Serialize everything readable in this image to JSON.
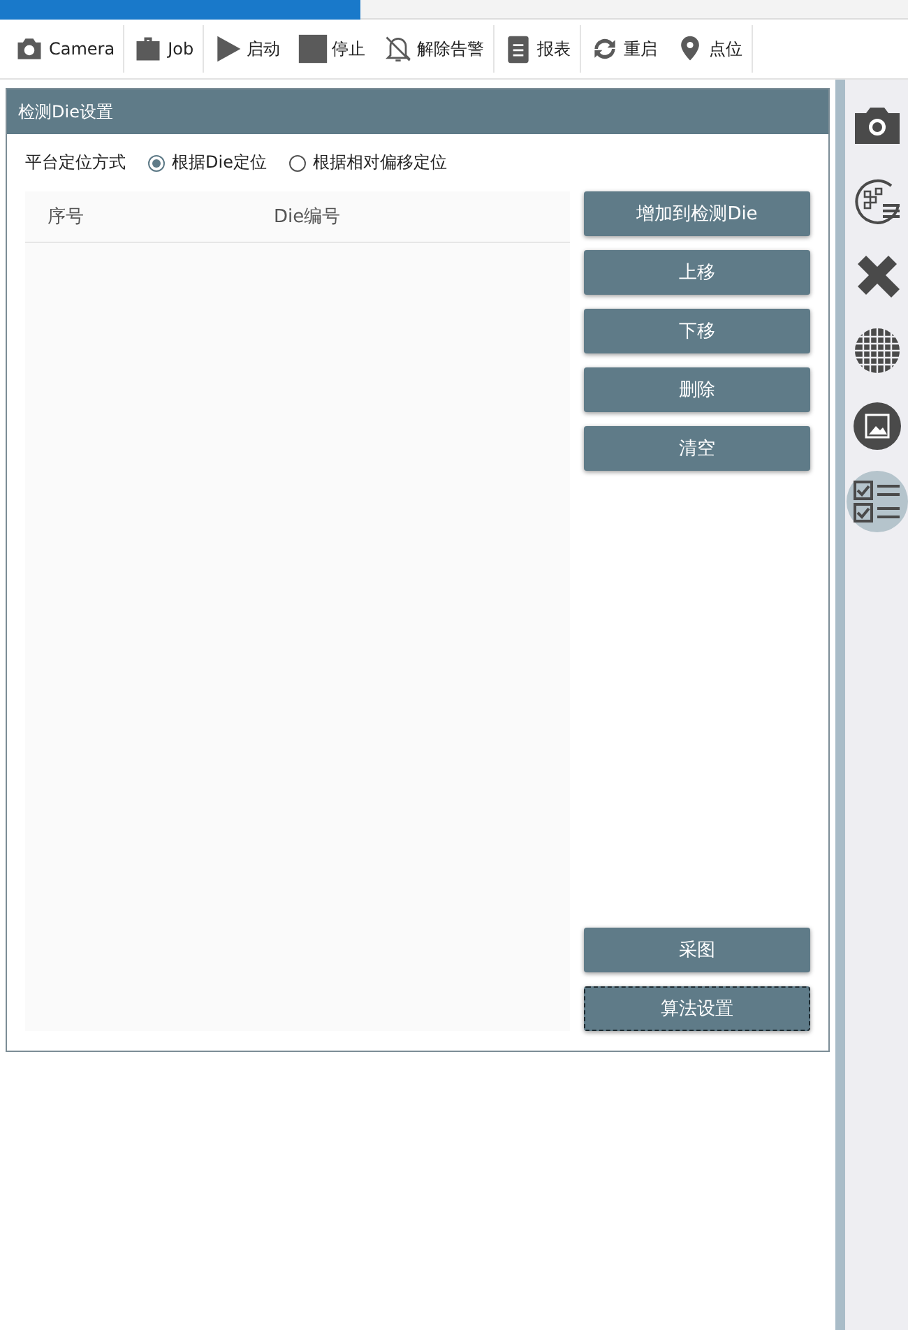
{
  "toolbar": [
    {
      "kind": "camera",
      "label": "Camera"
    },
    {
      "kind": "job",
      "label": "Job"
    },
    {
      "kind": "play",
      "label": "启动"
    },
    {
      "kind": "stop",
      "label": "停止"
    },
    {
      "kind": "bell-off",
      "label": "解除告警"
    },
    {
      "kind": "report",
      "label": "报表"
    },
    {
      "kind": "restart",
      "label": "重启"
    },
    {
      "kind": "pin",
      "label": "点位"
    }
  ],
  "panel": {
    "title": "检测Die设置",
    "positioning": {
      "label": "平台定位方式",
      "options": [
        {
          "label": "根据Die定位",
          "selected": true
        },
        {
          "label": "根据相对偏移定位",
          "selected": false
        }
      ]
    },
    "table": {
      "columns": [
        "序号",
        "Die编号"
      ]
    },
    "buttons": [
      {
        "label": "增加到检测Die",
        "focused": false
      },
      {
        "label": "上移",
        "focused": false
      },
      {
        "label": "下移",
        "focused": false
      },
      {
        "label": "删除",
        "focused": false
      },
      {
        "label": "清空",
        "focused": false
      }
    ],
    "bottom_buttons": [
      {
        "label": "采图",
        "focused": false
      },
      {
        "label": "算法设置",
        "focused": true
      }
    ]
  },
  "sidebar": [
    {
      "kind": "camera",
      "selected": false
    },
    {
      "kind": "map",
      "selected": false
    },
    {
      "kind": "tools",
      "selected": false
    },
    {
      "kind": "grid",
      "selected": false
    },
    {
      "kind": "image",
      "selected": false
    },
    {
      "kind": "checklist",
      "selected": true
    }
  ]
}
